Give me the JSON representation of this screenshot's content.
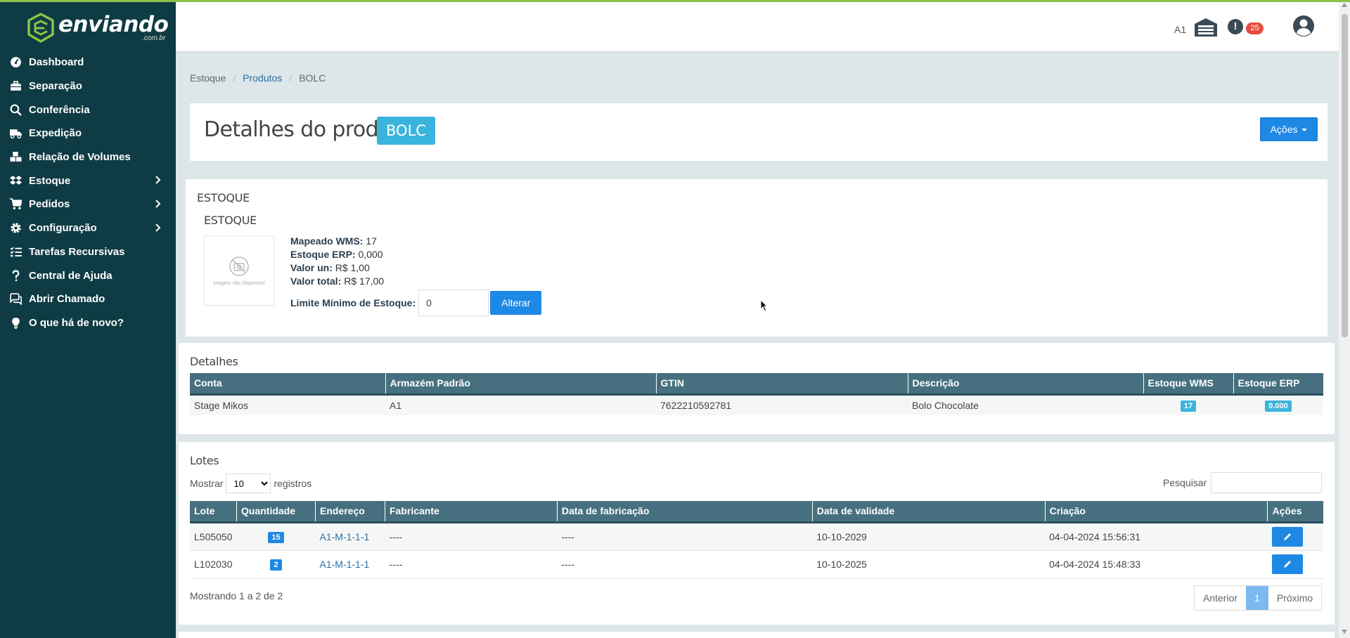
{
  "brand": {
    "name": "enviando",
    "sub": ".com.br"
  },
  "sidebar": {
    "items": [
      {
        "label": "Dashboard",
        "icon": "dashboard-icon"
      },
      {
        "label": "Separação",
        "icon": "briefcase-icon"
      },
      {
        "label": "Conferência",
        "icon": "search-icon"
      },
      {
        "label": "Expedição",
        "icon": "truck-icon"
      },
      {
        "label": "Relação de Volumes",
        "icon": "boxes-icon"
      },
      {
        "label": "Estoque",
        "icon": "dropbox-icon",
        "expandable": true
      },
      {
        "label": "Pedidos",
        "icon": "cart-icon",
        "expandable": true
      },
      {
        "label": "Configuração",
        "icon": "gear-icon",
        "expandable": true
      },
      {
        "label": "Tarefas Recursivas",
        "icon": "tasks-icon"
      },
      {
        "label": "Central de Ajuda",
        "icon": "question-icon"
      },
      {
        "label": "Abrir Chamado",
        "icon": "chat-icon"
      },
      {
        "label": "O que há de novo?",
        "icon": "lightbulb-icon"
      }
    ]
  },
  "header": {
    "warehouse": "A1",
    "notifications": "25",
    "alert_glyph": "!"
  },
  "breadcrumb": {
    "root": "Estoque",
    "section": "Produtos",
    "current": "BOLC"
  },
  "page": {
    "title": "Detalhes do produto",
    "code": "BOLC",
    "actions_label": "Ações"
  },
  "estoque": {
    "title": "ESTOQUE",
    "subtitle": "ESTOQUE",
    "image_placeholder": "Imagem não Disponível",
    "mapeado_label": "Mapeado WMS:",
    "mapeado_value": "17",
    "erp_label": "Estoque ERP:",
    "erp_value": "0,000",
    "valor_un_label": "Valor un:",
    "valor_un_value": "R$ 1,00",
    "valor_total_label": "Valor total:",
    "valor_total_value": "R$ 17,00",
    "limite_label": "Limite Mínimo de Estoque:",
    "limite_value": "0",
    "alterar_label": "Alterar"
  },
  "detalhes": {
    "title": "Detalhes",
    "columns": [
      "Conta",
      "Armazém Padrão",
      "GTIN",
      "Descrição",
      "Estoque WMS",
      "Estoque ERP"
    ],
    "row": {
      "conta": "Stage Mikos",
      "armazem": "A1",
      "gtin": "7622210592781",
      "descricao": "Bolo Chocolate",
      "estoque_wms": "17",
      "estoque_erp": "0.000"
    }
  },
  "lotes": {
    "title": "Lotes",
    "mostrar_label": "Mostrar",
    "page_size": "10",
    "registros_label": "registros",
    "pesquisar_label": "Pesquisar",
    "columns": [
      "Lote",
      "Quantidade",
      "Endereço",
      "Fabricante",
      "Data de fabricação",
      "Data de validade",
      "Criação",
      "Ações"
    ],
    "rows": [
      {
        "lote": "L505050",
        "quantidade": "15",
        "endereco": "A1-M-1-1-1",
        "fabricante": "----",
        "fabricacao": "----",
        "validade": "10-10-2029",
        "criacao": "04-04-2024 15:56:31"
      },
      {
        "lote": "L102030",
        "quantidade": "2",
        "endereco": "A1-M-1-1-1",
        "fabricante": "----",
        "fabricacao": "----",
        "validade": "10-10-2025",
        "criacao": "04-04-2024 15:48:33"
      }
    ],
    "summary": "Mostrando 1 a 2 de 2",
    "pager": {
      "prev": "Anterior",
      "current": "1",
      "next": "Próximo"
    }
  },
  "colors": {
    "sidebar": "#0f3b44",
    "accent": "#1e88e5",
    "badge": "#3ab4dc",
    "table_header": "#46707f",
    "brand_green": "#8bc34a"
  }
}
